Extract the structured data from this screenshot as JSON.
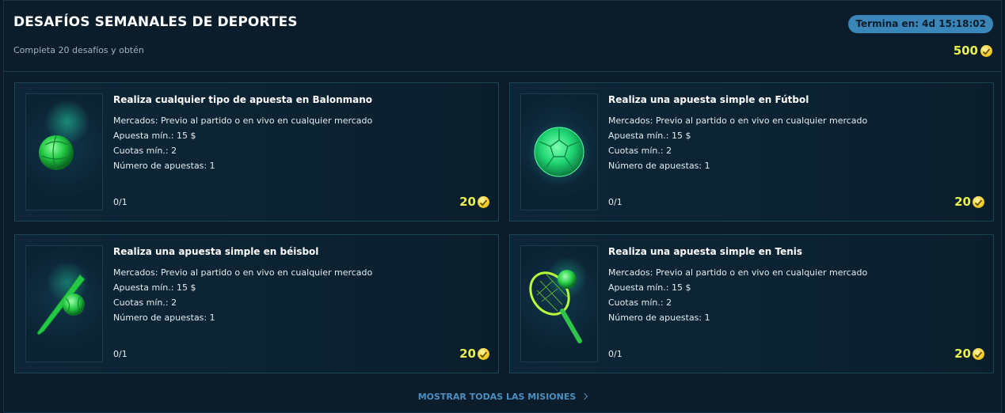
{
  "header": {
    "title": "DESAFÍOS SEMANALES DE DEPORTES",
    "subtitle": "Completa 20 desafíos y obtén",
    "timer": "Termina en: 4d 15:18:02",
    "total_reward": "500"
  },
  "cards": [
    {
      "title": "Realiza cualquier tipo de apuesta en Balonmano",
      "markets": "Mercados: Previo al partido o en vivo en cualquier mercado",
      "min_stake": "Apuesta mín.: 15 $",
      "min_odds": "Cuotas mín.: 2",
      "num_bets": "Número de apuestas: 1",
      "progress": "0/1",
      "reward": "20",
      "icon": "handball-icon"
    },
    {
      "title": "Realiza una apuesta simple en Fútbol",
      "markets": "Mercados: Previo al partido o en vivo en cualquier mercado",
      "min_stake": "Apuesta mín.: 15 $",
      "min_odds": "Cuotas mín.: 2",
      "num_bets": "Número de apuestas: 1",
      "progress": "0/1",
      "reward": "20",
      "icon": "soccer-ball-icon"
    },
    {
      "title": "Realiza una apuesta simple en béisbol",
      "markets": "Mercados: Previo al partido o en vivo en cualquier mercado",
      "min_stake": "Apuesta mín.: 15 $",
      "min_odds": "Cuotas mín.: 2",
      "num_bets": "Número de apuestas: 1",
      "progress": "0/1",
      "reward": "20",
      "icon": "baseball-bat-icon"
    },
    {
      "title": "Realiza una apuesta simple en Tenis",
      "markets": "Mercados: Previo al partido o en vivo en cualquier mercado",
      "min_stake": "Apuesta mín.: 15 $",
      "min_odds": "Cuotas mín.: 2",
      "num_bets": "Número de apuestas: 1",
      "progress": "0/1",
      "reward": "20",
      "icon": "tennis-racket-icon"
    }
  ],
  "footer": {
    "show_all_label": "MOSTRAR TODAS LAS MISIONES"
  },
  "colors": {
    "accent_yellow": "#e9f24b",
    "timer_badge": "#3a86b8",
    "link_blue": "#4a8fc0",
    "icon_green": "#2ee05a"
  }
}
